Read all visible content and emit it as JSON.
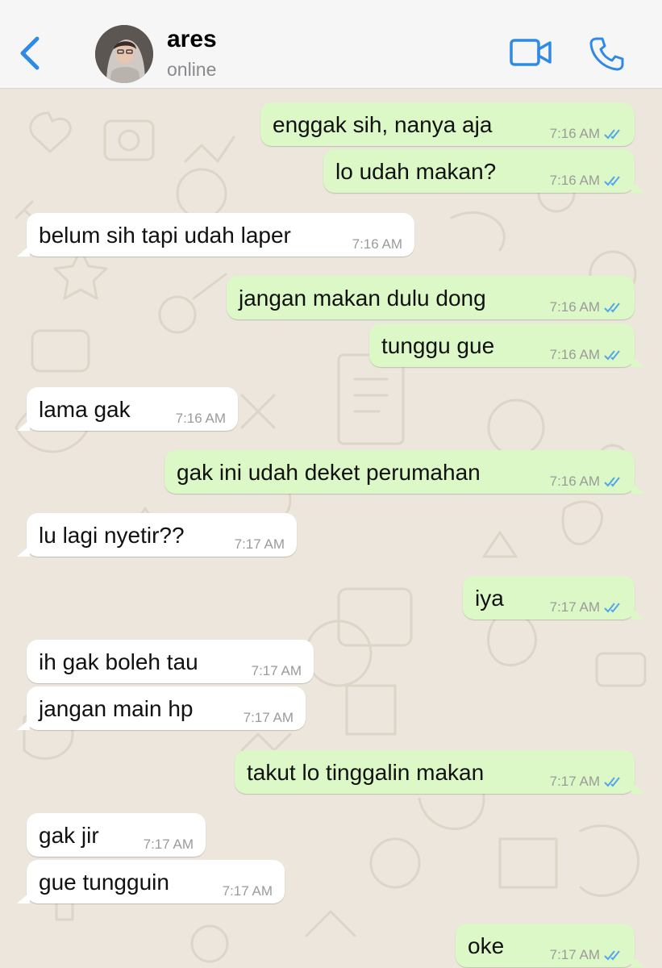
{
  "header": {
    "contact_name": "ares",
    "status": "online",
    "icons": {
      "back": "chevron-left-icon",
      "video": "video-call-icon",
      "phone": "voice-call-icon"
    },
    "accent_color": "#2f8ae6"
  },
  "colors": {
    "outgoing_bubble": "#dcf8c6",
    "incoming_bubble": "#ffffff",
    "read_ticks": "#53a6e8",
    "timestamp": "#9b9b9b"
  },
  "messages": [
    {
      "direction": "out",
      "text": "enggak sih, nanya aja",
      "time": "7:16 AM",
      "status": "read"
    },
    {
      "direction": "out",
      "text": "lo udah makan?",
      "time": "7:16 AM",
      "status": "read"
    },
    {
      "direction": "in",
      "text": "belum sih tapi udah laper",
      "time": "7:16 AM"
    },
    {
      "direction": "out",
      "text": "jangan makan dulu dong",
      "time": "7:16 AM",
      "status": "read"
    },
    {
      "direction": "out",
      "text": "tunggu gue",
      "time": "7:16 AM",
      "status": "read"
    },
    {
      "direction": "in",
      "text": "lama gak",
      "time": "7:16 AM"
    },
    {
      "direction": "out",
      "text": "gak ini udah deket perumahan",
      "time": "7:16 AM",
      "status": "read"
    },
    {
      "direction": "in",
      "text": "lu lagi nyetir??",
      "time": "7:17 AM"
    },
    {
      "direction": "out",
      "text": "iya",
      "time": "7:17 AM",
      "status": "read"
    },
    {
      "direction": "in",
      "text": "ih gak boleh tau",
      "time": "7:17 AM"
    },
    {
      "direction": "in",
      "text": "jangan main hp",
      "time": "7:17 AM"
    },
    {
      "direction": "out",
      "text": "takut lo tinggalin makan",
      "time": "7:17 AM",
      "status": "read"
    },
    {
      "direction": "in",
      "text": "gak jir",
      "time": "7:17 AM"
    },
    {
      "direction": "in",
      "text": "gue tungguin",
      "time": "7:17 AM"
    },
    {
      "direction": "out",
      "text": "oke",
      "time": "7:17 AM",
      "status": "read"
    }
  ]
}
